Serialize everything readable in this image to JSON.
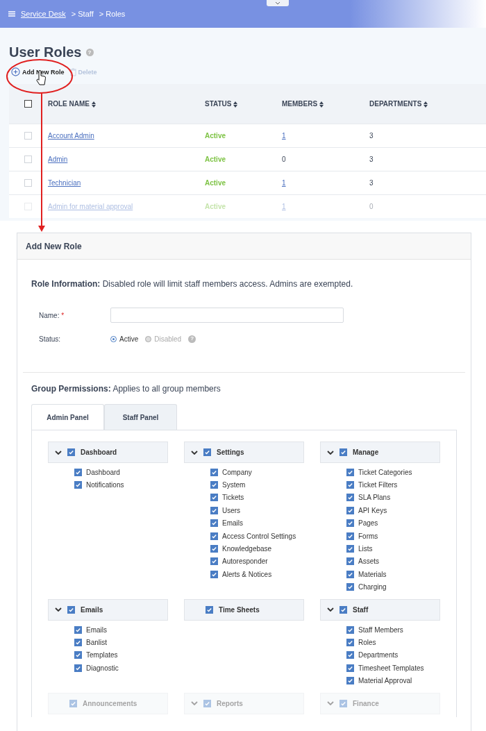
{
  "breadcrumb": {
    "items": [
      {
        "label": "Service Desk",
        "kind": "link"
      },
      {
        "label": "> Staff",
        "kind": "text"
      },
      {
        "label": "> Roles",
        "kind": "text"
      }
    ]
  },
  "page_title": "User Roles",
  "page_title_help": "?",
  "toolbar": [
    {
      "label": "Add New Role",
      "disabled": false,
      "kind": "add"
    },
    {
      "label": "Delete",
      "disabled": true,
      "kind": "delete"
    }
  ],
  "table": {
    "select_all_checked": false,
    "columns": [
      "ROLE NAME",
      "STATUS",
      "MEMBERS",
      "DEPARTMENTS"
    ],
    "rows": [
      {
        "checked": false,
        "name": "Account Admin",
        "status": "Active",
        "members": "1",
        "members_link": true,
        "departments": "3"
      },
      {
        "checked": false,
        "name": "Admin",
        "status": "Active",
        "members": "0",
        "members_link": false,
        "departments": "3"
      },
      {
        "checked": false,
        "name": "Technician",
        "status": "Active",
        "members": "1",
        "members_link": true,
        "departments": "3"
      },
      {
        "checked": false,
        "name": "Admin for material approval",
        "status": "Active",
        "members": "1",
        "members_link": true,
        "departments": "0"
      }
    ]
  },
  "panel": {
    "title": "Add New Role",
    "role_info": "**Role Information:** Disabled role will limit staff members access. Admins are exempted.",
    "name_field": {
      "label": "Name:",
      "required_mark": "*"
    },
    "status_field": {
      "label": "Status:",
      "help": "?",
      "options": [
        {
          "label": "Active",
          "selected": true
        },
        {
          "label": "Disabled",
          "selected": false
        }
      ]
    },
    "group_permissions": "**Group Permissions:** Applies to all group members",
    "tabs": [
      {
        "label": "Admin Panel",
        "selected": true
      },
      {
        "label": "Staff Panel",
        "selected": false
      }
    ],
    "groups": [
      {
        "title": "Dashboard",
        "checked": true,
        "expandable": true,
        "items": [
          {
            "label": "Dashboard",
            "checked": true
          },
          {
            "label": "Notifications",
            "checked": true
          }
        ]
      },
      {
        "title": "Settings",
        "checked": true,
        "expandable": true,
        "items": [
          {
            "label": "Company",
            "checked": true
          },
          {
            "label": "System",
            "checked": true
          },
          {
            "label": "Tickets",
            "checked": true
          },
          {
            "label": "Users",
            "checked": true
          },
          {
            "label": "Emails",
            "checked": true
          },
          {
            "label": "Access Control Settings",
            "checked": true
          },
          {
            "label": "Knowledgebase",
            "checked": true
          },
          {
            "label": "Autoresponder",
            "checked": true
          },
          {
            "label": "Alerts & Notices",
            "checked": true
          }
        ]
      },
      {
        "title": "Manage",
        "checked": true,
        "expandable": true,
        "items": [
          {
            "label": "Ticket Categories",
            "checked": true
          },
          {
            "label": "Ticket Filters",
            "checked": true
          },
          {
            "label": "SLA Plans",
            "checked": true
          },
          {
            "label": "API Keys",
            "checked": true
          },
          {
            "label": "Pages",
            "checked": true
          },
          {
            "label": "Forms",
            "checked": true
          },
          {
            "label": "Lists",
            "checked": true
          },
          {
            "label": "Assets",
            "checked": true
          },
          {
            "label": "Materials",
            "checked": true
          },
          {
            "label": "Charging",
            "checked": true
          }
        ]
      },
      {
        "title": "Emails",
        "checked": true,
        "expandable": true,
        "items": [
          {
            "label": "Emails",
            "checked": true
          },
          {
            "label": "Banlist",
            "checked": true
          },
          {
            "label": "Templates",
            "checked": true
          },
          {
            "label": "Diagnostic",
            "checked": true
          }
        ]
      },
      {
        "title": "Time Sheets",
        "checked": true,
        "expandable": false
      },
      {
        "title": "Staff",
        "checked": true,
        "expandable": true,
        "items": [
          {
            "label": "Staff Members",
            "checked": true
          },
          {
            "label": "Roles",
            "checked": true
          },
          {
            "label": "Departments",
            "checked": true
          },
          {
            "label": "Timesheet Templates",
            "checked": true
          },
          {
            "label": "Material Approval",
            "checked": true
          }
        ]
      },
      {
        "title": "Announcements",
        "checked": true,
        "expandable": false
      },
      {
        "title": "Reports",
        "checked": true,
        "expandable": true
      },
      {
        "title": "Finance",
        "checked": true,
        "expandable": true
      }
    ]
  }
}
